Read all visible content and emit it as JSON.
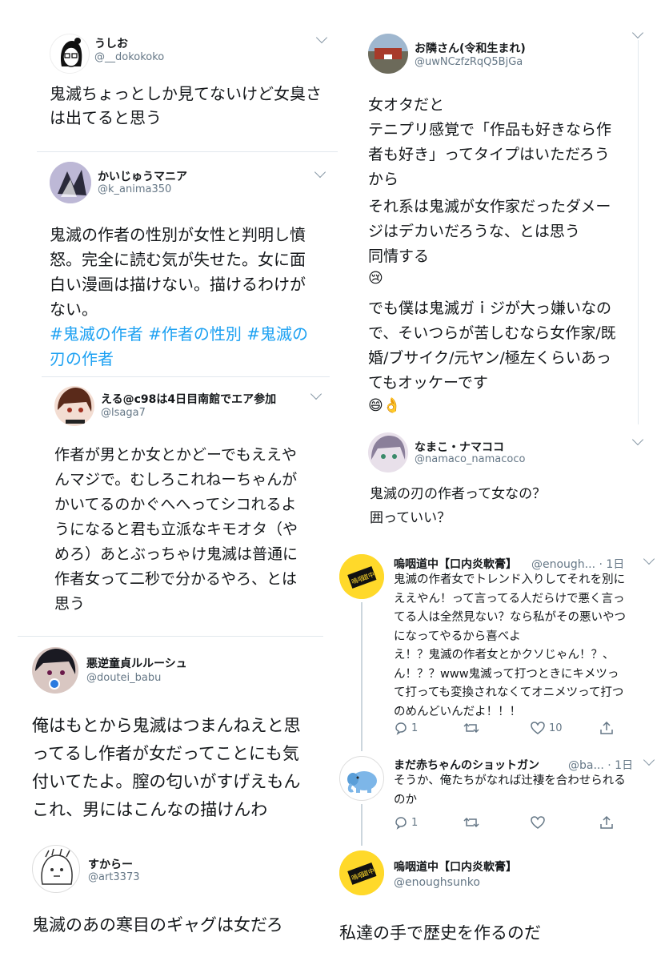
{
  "t1": {
    "name": "うしお",
    "handle": "@__dokokoko",
    "lines": [
      "鬼滅ちょっとしか見てないけど女臭さ",
      "は出てると思う"
    ]
  },
  "t2": {
    "name": "かいじゅうマニア",
    "handle": "@k_anima350",
    "lines": [
      "鬼滅の作者の性別が女性と判明し憤",
      "怒。完全に読む気が失せた。女に面",
      "白い漫画は描けない。描けるわけが",
      "ない。"
    ],
    "tags": [
      "#鬼滅の作者 #作者の性別 #鬼滅の",
      "刃の作者"
    ]
  },
  "t3": {
    "name": "える@c98は4日目南館でエア参加",
    "handle": "@lsaga7",
    "lines": [
      "作者が男とか女とかどーでもええや",
      "んマジで。むしろこれねーちゃんが",
      "かいてるのかぐへへってシコれるよ",
      "うになると君も立派なキモオタ（や",
      "めろ）あとぶっちゃけ鬼滅は普通に",
      "作者女って二秒で分かるやろ、とは",
      "思う"
    ]
  },
  "t4": {
    "name": "悪逆童貞ルルーシュ",
    "handle": "@doutei_babu",
    "lines": [
      "俺はもとから鬼滅はつまんねえと思",
      "ってるし作者が女だってことにも気",
      "付いてたよ。膣の匂いがすげえもん",
      "これ、男にはこんなの描けんわ"
    ]
  },
  "t5": {
    "name": "すからー",
    "handle": "@art3373",
    "lines": [
      "鬼滅のあの寒目のギャグは女だろ"
    ]
  },
  "r1": {
    "name": "お隣さん(令和生まれ)",
    "handle": "@uwNCzfzRqQ5BjGa",
    "lines": [
      "女オタだと",
      "テニプリ感覚で「作品も好きなら作",
      "者も好き」ってタイプはいただろう",
      "から"
    ],
    "lines2": [
      "それ系は鬼滅が女作家だったダメー",
      "ジはデカいだろうな、とは思う",
      "同情する"
    ],
    "emoji1": "😢",
    "lines3": [
      "でも僕は鬼滅ガｉジが大っ嫌いなの",
      "で、そいつらが苦しむなら女作家/既",
      "婚/ブサイク/元ヤン/極左くらいあっ",
      "てもオッケーです"
    ],
    "emoji2": "😄👌"
  },
  "r2": {
    "name": "なまこ・ナマココ",
    "handle": "@namaco_namacoco",
    "lines": [
      "鬼滅の刃の作者って女なの？",
      "囲っていい？"
    ]
  },
  "r3": {
    "name": "嗚咽道中【口内炎軟膏】",
    "handle_time": "@enough... · 1日",
    "lines": [
      "鬼滅の作者女でトレンド入りしてそれを別に",
      "ええやん！って言ってる人だらけで悪く言っ",
      "てる人は全然見ない？なら私がその悪いやつ",
      "になってやるから喜べよ",
      "え！？鬼滅の作者女とかクソじゃん！？、",
      "ん！？？www鬼滅って打つときにキメツっ",
      "て打っても変換されなくてオニメツって打つ",
      "のめんどいんだよ！！！"
    ],
    "reply_count": "1",
    "like_count": "10",
    "avatar_text": [
      "嗚咽",
      "道中"
    ]
  },
  "r4": {
    "name": "まだ赤ちゃんのショットガン",
    "handle_time": "@ba... · 1日",
    "lines": [
      "そうか、俺たちがなれば辻褄を合わせられる",
      "のか"
    ],
    "reply_count": "1"
  },
  "r5": {
    "name": "嗚咽道中【口内炎軟膏】",
    "handle": "@enoughsunko",
    "lines": [
      "私達の手で歴史を作るのだ"
    ],
    "avatar_text": [
      "嗚咽",
      "道中"
    ]
  },
  "colors": {
    "text": "#14171a",
    "muted": "#657786",
    "link": "#1da1f2",
    "line": "#e1e8ed"
  }
}
